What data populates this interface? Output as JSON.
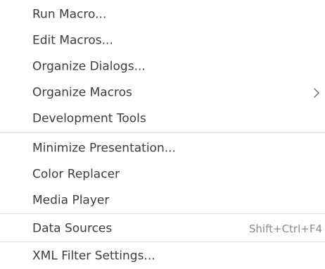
{
  "menu": {
    "items": [
      {
        "label": "Run Macro..."
      },
      {
        "label": "Edit Macros..."
      },
      {
        "label": "Organize Dialogs..."
      },
      {
        "label": "Organize Macros"
      },
      {
        "label": "Development Tools"
      },
      {
        "label": "Minimize Presentation..."
      },
      {
        "label": "Color Replacer"
      },
      {
        "label": "Media Player"
      },
      {
        "label": "Data Sources",
        "shortcut": "Shift+Ctrl+F4"
      },
      {
        "label": "XML Filter Settings..."
      }
    ],
    "submenu_icon": "chevron-right-icon"
  }
}
